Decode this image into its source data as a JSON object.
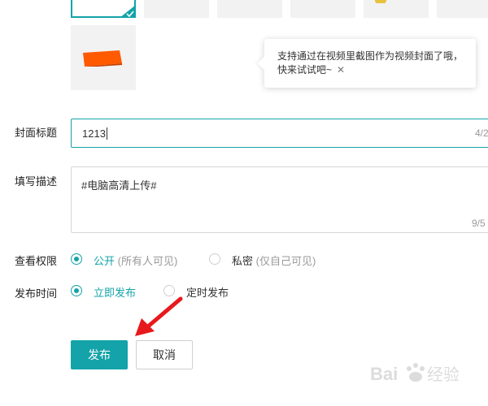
{
  "tooltip": {
    "text": "支持通过在视频里截图作为视频封面了哦，快来试试吧~",
    "close_glyph": "✕"
  },
  "form": {
    "cover_title": {
      "label": "封面标题",
      "value": "1213",
      "counter": "4/2"
    },
    "description": {
      "label": "填写描述",
      "value": "#电脑高清上传#",
      "counter": "9/5"
    },
    "visibility": {
      "label": "查看权限",
      "options": [
        {
          "label": "公开",
          "hint": "(所有人可见)",
          "selected": true
        },
        {
          "label": "私密",
          "hint": "(仅自己可见)",
          "selected": false
        }
      ]
    },
    "publish_time": {
      "label": "发布时间",
      "options": [
        {
          "label": "立即发布",
          "selected": true
        },
        {
          "label": "定时发布",
          "selected": false
        }
      ]
    }
  },
  "actions": {
    "publish_label": "发布",
    "cancel_label": "取消"
  },
  "watermark": {
    "text": "Bai经验"
  },
  "colors": {
    "accent": "#13a3a8",
    "arrow": "#e8191c",
    "cover_orange": "#ff5a00"
  }
}
